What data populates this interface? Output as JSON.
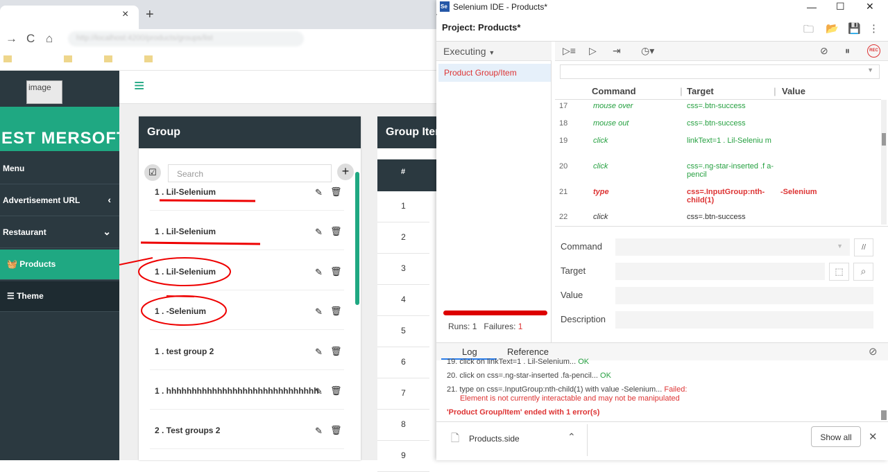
{
  "browser": {
    "tab_close": "×",
    "new_tab": "+",
    "url": "http://localhost:4200/products/groups/list"
  },
  "app": {
    "logo_alt": "image",
    "brand": "EST MERSOFT",
    "sidebar": [
      {
        "label": "Menu"
      },
      {
        "label": "Advertisement URL",
        "chevron": "‹"
      },
      {
        "label": "Restaurant",
        "chevron": "⌄"
      },
      {
        "label": "Products"
      },
      {
        "label": "Theme"
      }
    ],
    "group": {
      "title": "Group",
      "search_placeholder": "Search",
      "rows": [
        "1 . Lil-Selenium",
        "1 . Lil-Selenium",
        "1 . Lil-Selenium",
        "1 . -Selenium",
        "1 . test group 2",
        "1 . hhhhhhhhhhhhhhhhhhhhhhhhhhhhhhhhhhhhh",
        "2 . Test groups 2"
      ]
    },
    "items": {
      "title": "Group Items",
      "col_hash": "#",
      "row_numbers": [
        "1",
        "2",
        "3",
        "4",
        "5",
        "6",
        "7",
        "8",
        "9"
      ]
    }
  },
  "ide": {
    "title": "Selenium IDE - Products*",
    "project_label": "Project:",
    "project_name": "Products*",
    "executing_label": "Executing",
    "test_name": "Product Group/Item",
    "runs_label": "Runs:",
    "runs": "1",
    "failures_label": "Failures:",
    "failures": "1",
    "columns": {
      "command": "Command",
      "target": "Target",
      "value": "Value"
    },
    "commands": [
      {
        "n": "17",
        "command": "mouse over",
        "target": "css=.btn-success",
        "value": "",
        "state": "ok"
      },
      {
        "n": "18",
        "command": "mouse out",
        "target": "css=.btn-success",
        "value": "",
        "state": "ok"
      },
      {
        "n": "19",
        "command": "click",
        "target": "linkText=1 . Lil-Seleniu m",
        "value": "",
        "state": "ok"
      },
      {
        "n": "20",
        "command": "click",
        "target": "css=.ng-star-inserted .f a-pencil",
        "value": "",
        "state": "ok"
      },
      {
        "n": "21",
        "command": "type",
        "target": "css=.InputGroup:nth-child(1)",
        "value": "-Selenium",
        "state": "fail"
      },
      {
        "n": "22",
        "command": "click",
        "target": "css=.btn-success",
        "value": "",
        "state": "plain"
      }
    ],
    "editor": {
      "command_label": "Command",
      "target_label": "Target",
      "value_label": "Value",
      "description_label": "Description",
      "comment_btn": "//"
    },
    "log_tab": "Log",
    "reference_tab": "Reference",
    "log": [
      {
        "text": "19. click on linkText=1 . Lil-Selenium...",
        "status": "OK"
      },
      {
        "text": "20. click on css=.ng-star-inserted .fa-pencil...",
        "status": "OK"
      },
      {
        "text": "21. type on css=.InputGroup:nth-child(1) with value -Selenium...",
        "status": "Failed:"
      },
      {
        "text": "Element is not currently interactable and may not be manipulated"
      },
      {
        "text": "'Product Group/Item' ended with 1 error(s)"
      }
    ]
  },
  "downloads": {
    "file": "Products.side",
    "show_all": "Show all",
    "close": "✕"
  },
  "colors": {
    "accent": "#1fa882",
    "sidebar": "#2b3940",
    "error": "#dd3333",
    "ok": "#25a040"
  }
}
